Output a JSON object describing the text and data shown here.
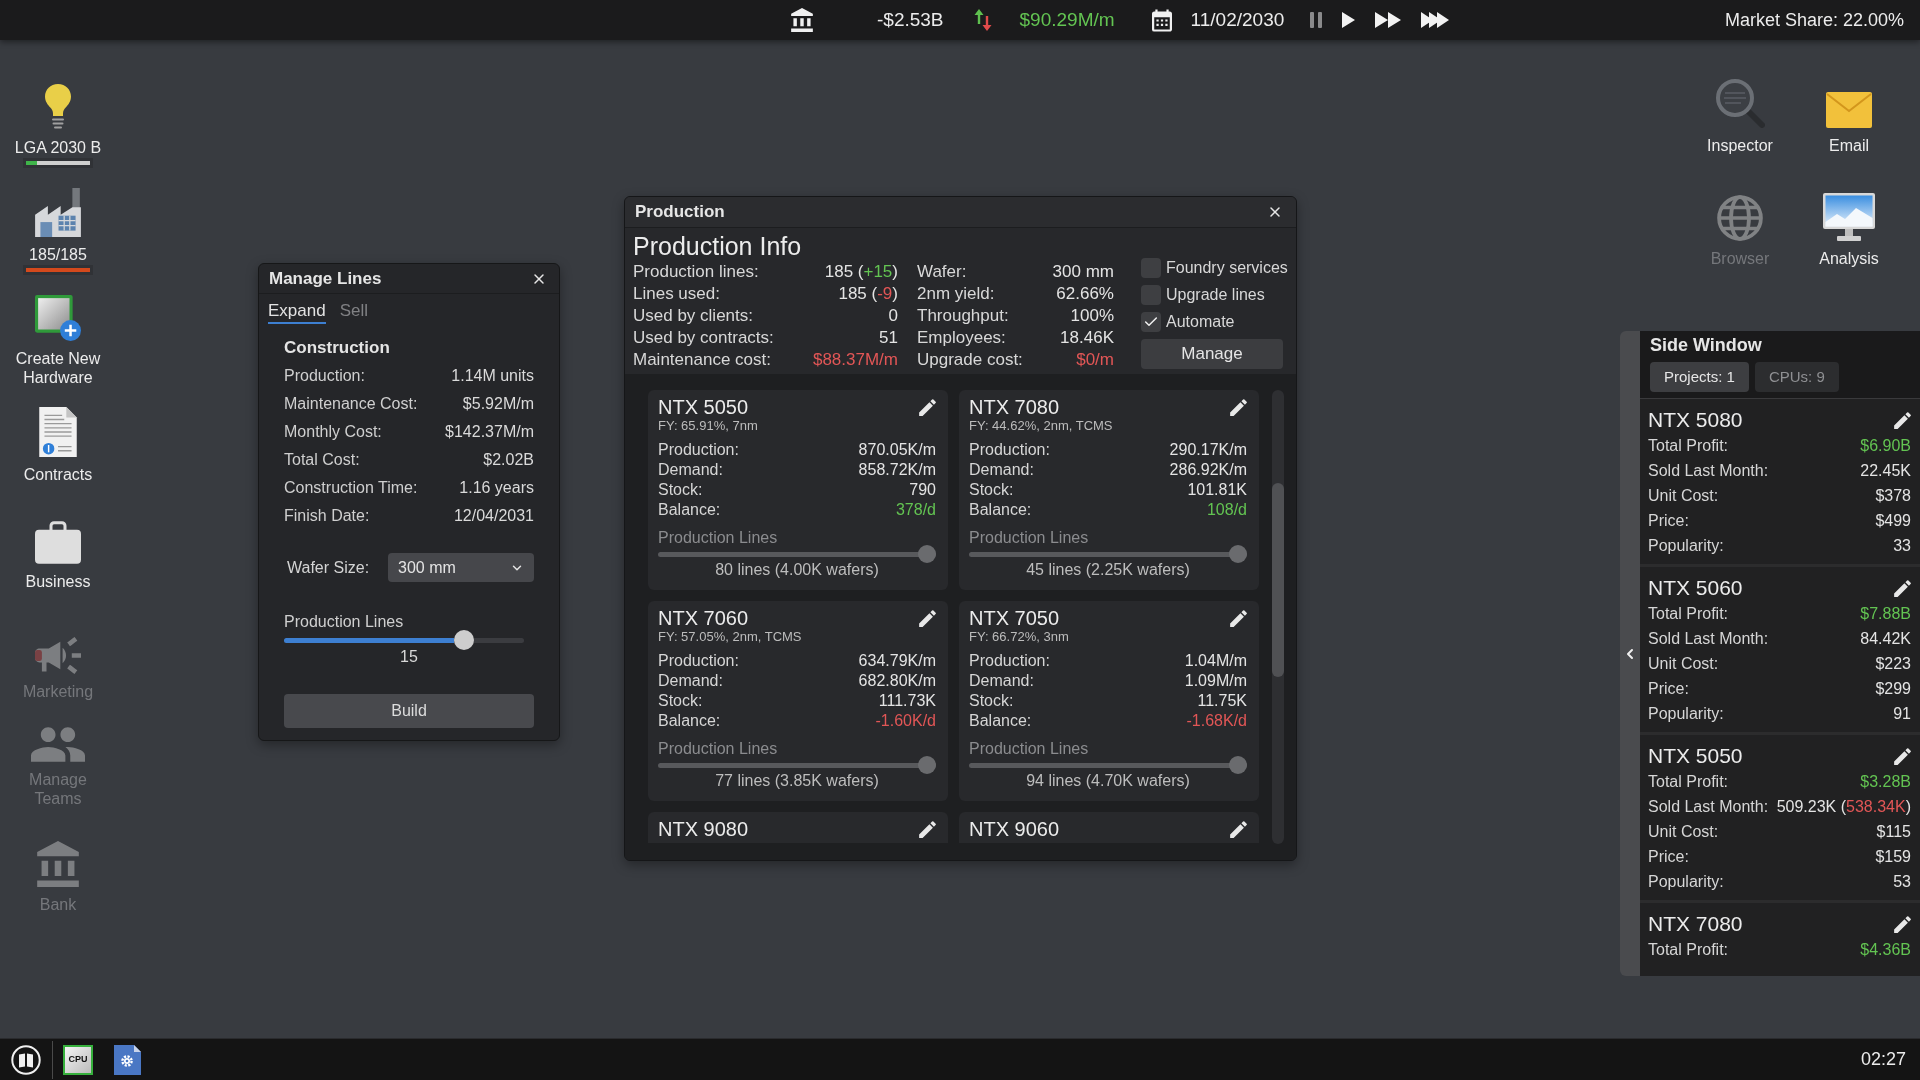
{
  "top_bar": {
    "balance": "-$2.53B",
    "income": "$90.29M/m",
    "date": "11/02/2030",
    "speed_controls": [
      {
        "kind": "pause"
      },
      {
        "kind": "play"
      },
      {
        "kind": "fast"
      },
      {
        "kind": "fastest"
      }
    ],
    "market_share": "Market Share: 22.00%"
  },
  "desktop_icons": [
    {
      "kind": "idea",
      "label": "LGA 2030 B",
      "disabled": false,
      "level": 0.17,
      "color": "#3fb44a"
    },
    {
      "kind": "factory",
      "label": "185/185",
      "disabled": false,
      "level": 1,
      "color": "#d4491c"
    },
    {
      "kind": "new_hardware",
      "label": "Create New Hardware",
      "disabled": false
    },
    {
      "kind": "contracts",
      "label": "Contracts",
      "disabled": false
    },
    {
      "kind": "business",
      "label": "Business",
      "disabled": false
    },
    {
      "kind": "marketing",
      "label": "Marketing",
      "disabled": true
    },
    {
      "kind": "teams",
      "label": "Manage Teams",
      "disabled": true
    },
    {
      "kind": "bank",
      "label": "Bank",
      "disabled": true
    }
  ],
  "apps": [
    {
      "kind": "inspector",
      "label": "Inspector",
      "disabled": false
    },
    {
      "kind": "email",
      "label": "Email",
      "disabled": false
    },
    {
      "kind": "browser",
      "label": "Browser",
      "disabled": true
    },
    {
      "kind": "analysis",
      "label": "Analysis",
      "disabled": false
    }
  ],
  "manage_lines": {
    "title": "Manage Lines",
    "tabs": [
      {
        "label": "Expand",
        "selected": true
      },
      {
        "label": "Sell",
        "selected": false
      }
    ],
    "section": "Construction",
    "rows": [
      {
        "label": "Production:",
        "value": "1.14M units"
      },
      {
        "label": "Maintenance Cost:",
        "value": "$5.92M/m"
      },
      {
        "label": "Monthly Cost:",
        "value": "$142.37M/m"
      },
      {
        "label": "Total Cost:",
        "value": "$2.02B"
      },
      {
        "label": "Construction Time:",
        "value": "1.16 years"
      },
      {
        "label": "Finish Date:",
        "value": "12/04/2031"
      }
    ],
    "wafer_size": {
      "label": "Wafer Size:",
      "value": "300 mm"
    },
    "lines_slider": {
      "label": "Production Lines",
      "level": 0.75,
      "value": "15"
    },
    "button": "Build"
  },
  "production": {
    "title": "Production",
    "heading": "Production Info",
    "stats_left": [
      {
        "label": "Production lines:",
        "parts": [
          {
            "text": "185 ("
          },
          {
            "text": "+15",
            "color": "#63c452"
          },
          {
            "text": ")"
          }
        ]
      },
      {
        "label": "Lines used:",
        "parts": [
          {
            "text": "185 ("
          },
          {
            "text": "-9",
            "color": "#e25656"
          },
          {
            "text": ")"
          }
        ]
      },
      {
        "label": "Used by clients:",
        "value": "0"
      },
      {
        "label": "Used by contracts:",
        "value": "51"
      },
      {
        "label": "Maintenance cost:",
        "value": "$88.37M/m",
        "color": "#e25656"
      }
    ],
    "stats_right": [
      {
        "label": "Wafer:",
        "value": "300 mm"
      },
      {
        "label": "2nm yield:",
        "value": "62.66%"
      },
      {
        "label": "Throughput:",
        "value": "100%"
      },
      {
        "label": "Employees:",
        "value": "18.46K"
      },
      {
        "label": "Upgrade cost:",
        "value": "$0/m",
        "color": "#e25656"
      }
    ],
    "options": [
      {
        "label": "Foundry services",
        "checked": false
      },
      {
        "label": "Upgrade lines",
        "checked": false
      },
      {
        "label": "Automate",
        "checked": true
      }
    ],
    "button": "Manage",
    "products": [
      {
        "name": "NTX 5050",
        "specs": "FY: 65.91%, 7nm",
        "rows": [
          {
            "label": "Production:",
            "value": "870.05K/m"
          },
          {
            "label": "Demand:",
            "value": "858.72K/m"
          },
          {
            "label": "Stock:",
            "value": "790"
          },
          {
            "label": "Balance:",
            "value": "378/d",
            "color": "#63c452"
          }
        ],
        "slider": {
          "label": "Production Lines",
          "level": 1,
          "caption": "80 lines (4.00K wafers)"
        }
      },
      {
        "name": "NTX 7080",
        "specs": "FY: 44.62%, 2nm, TCMS",
        "rows": [
          {
            "label": "Production:",
            "value": "290.17K/m"
          },
          {
            "label": "Demand:",
            "value": "286.92K/m"
          },
          {
            "label": "Stock:",
            "value": "101.81K"
          },
          {
            "label": "Balance:",
            "value": "108/d",
            "color": "#63c452"
          }
        ],
        "slider": {
          "label": "Production Lines",
          "level": 1,
          "caption": "45 lines (2.25K wafers)"
        }
      },
      {
        "name": "NTX 7060",
        "specs": "FY: 57.05%, 2nm, TCMS",
        "rows": [
          {
            "label": "Production:",
            "value": "634.79K/m"
          },
          {
            "label": "Demand:",
            "value": "682.80K/m"
          },
          {
            "label": "Stock:",
            "value": "111.73K"
          },
          {
            "label": "Balance:",
            "value": "-1.60K/d",
            "color": "#e25656"
          }
        ],
        "slider": {
          "label": "Production Lines",
          "level": 1,
          "caption": "77 lines (3.85K wafers)"
        }
      },
      {
        "name": "NTX 7050",
        "specs": "FY: 66.72%, 3nm",
        "rows": [
          {
            "label": "Production:",
            "value": "1.04M/m"
          },
          {
            "label": "Demand:",
            "value": "1.09M/m"
          },
          {
            "label": "Stock:",
            "value": "11.75K"
          },
          {
            "label": "Balance:",
            "value": "-1.68K/d",
            "color": "#e25656"
          }
        ],
        "slider": {
          "label": "Production Lines",
          "level": 1,
          "caption": "94 lines (4.70K wafers)"
        }
      },
      {
        "name": "NTX 9080"
      },
      {
        "name": "NTX 9060"
      }
    ]
  },
  "side_window": {
    "title": "Side Window",
    "tabs": [
      {
        "label": "Projects: 1",
        "selected": true
      },
      {
        "label": "CPUs: 9",
        "selected": false
      }
    ],
    "projects": [
      {
        "name": "NTX 5080",
        "rows": [
          {
            "label": "Total Profit:",
            "value": "$6.90B",
            "color": "#63c452"
          },
          {
            "label": "Sold Last Month:",
            "value": "22.45K"
          },
          {
            "label": "Unit Cost:",
            "value": "$378"
          },
          {
            "label": "Price:",
            "value": "$499"
          },
          {
            "label": "Popularity:",
            "value": "33"
          }
        ]
      },
      {
        "name": "NTX 5060",
        "rows": [
          {
            "label": "Total Profit:",
            "value": "$7.88B",
            "color": "#63c452"
          },
          {
            "label": "Sold Last Month:",
            "value": "84.42K"
          },
          {
            "label": "Unit Cost:",
            "value": "$223"
          },
          {
            "label": "Price:",
            "value": "$299"
          },
          {
            "label": "Popularity:",
            "value": "91"
          }
        ]
      },
      {
        "name": "NTX 5050",
        "rows": [
          {
            "label": "Total Profit:",
            "value": "$3.28B",
            "color": "#63c452"
          },
          {
            "label": "Sold Last Month:",
            "parts": [
              {
                "text": "509.23K ("
              },
              {
                "text": "538.34K",
                "color": "#e25656"
              },
              {
                "text": ")"
              }
            ]
          },
          {
            "label": "Unit Cost:",
            "value": "$115"
          },
          {
            "label": "Price:",
            "value": "$159"
          },
          {
            "label": "Popularity:",
            "value": "53"
          }
        ]
      },
      {
        "name": "NTX 7080",
        "rows": [
          {
            "label": "Total Profit:",
            "value": "$4.36B",
            "color": "#63c452"
          }
        ]
      }
    ]
  },
  "taskbar": {
    "apps": [
      {
        "kind": "cpu",
        "label": "CPU"
      },
      {
        "kind": "settings"
      }
    ],
    "clock": "02:27"
  }
}
